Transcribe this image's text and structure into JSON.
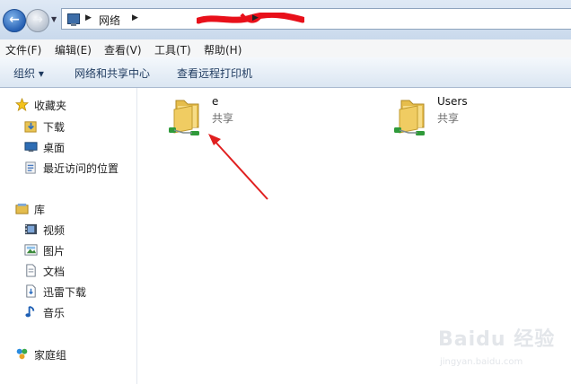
{
  "address": {
    "crumbs": [
      "网络",
      "",
      ""
    ]
  },
  "menu": [
    "文件(F)",
    "编辑(E)",
    "查看(V)",
    "工具(T)",
    "帮助(H)"
  ],
  "commands": {
    "organize": "组织 ▾",
    "network_center": "网络和共享中心",
    "printers": "查看远程打印机"
  },
  "nav": {
    "favorites": "收藏夹",
    "fav_items": [
      "下载",
      "桌面",
      "最近访问的位置"
    ],
    "library": "库",
    "lib_items": [
      "视频",
      "图片",
      "文档",
      "迅雷下载",
      "音乐"
    ],
    "homegroup": "家庭组"
  },
  "shares": [
    {
      "name": "e",
      "type": "共享"
    },
    {
      "name": "Users",
      "type": "共享"
    }
  ],
  "watermark": {
    "logo": "Baidu 经验",
    "url": "jingyan.baidu.com"
  },
  "colors": {
    "annotation": "#e02020",
    "scribble": "#e8101a"
  }
}
